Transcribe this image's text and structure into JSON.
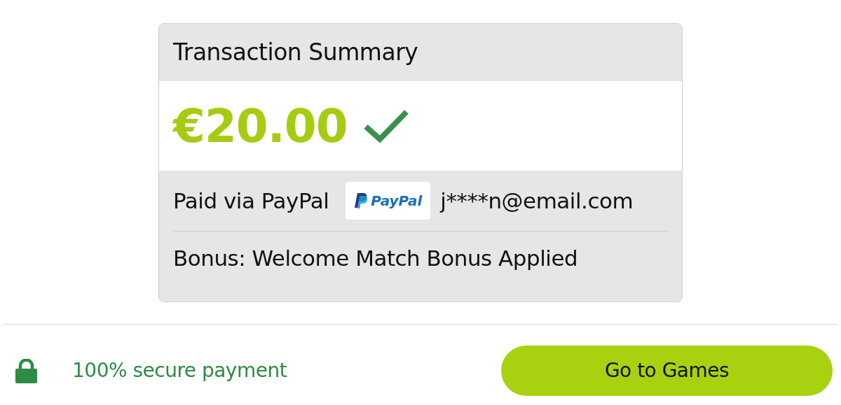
{
  "summary": {
    "title": "Transaction Summary",
    "amount": "€20.00",
    "confirmed": true,
    "payment": {
      "label": "Paid via PayPal",
      "logo_text": "PayPal",
      "account": "j****n@email.com"
    },
    "bonus": "Bonus: Welcome Match Bonus Applied"
  },
  "footer": {
    "secure_text": "100% secure payment",
    "button": "Go to Games"
  }
}
